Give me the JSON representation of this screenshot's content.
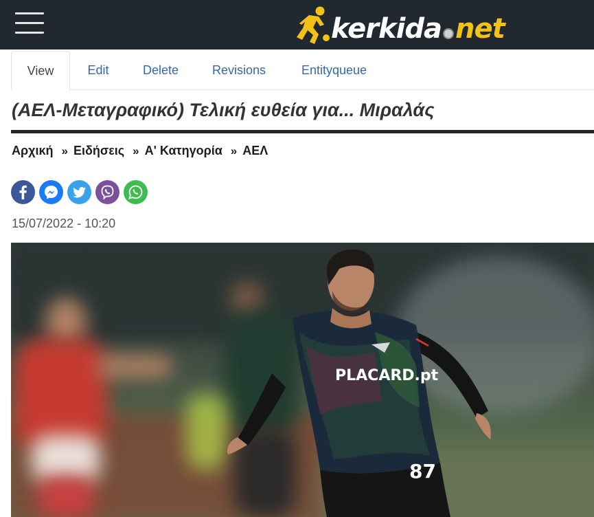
{
  "header": {
    "menu_icon": "hamburger-menu-icon",
    "logo": {
      "word": "kerkida",
      "tld": "net",
      "separator_icon": "football-icon",
      "mark_icon": "running-player-icon",
      "mark_color": "#f2c316"
    }
  },
  "tabs": [
    {
      "label": "View",
      "active": true
    },
    {
      "label": "Edit",
      "active": false
    },
    {
      "label": "Delete",
      "active": false
    },
    {
      "label": "Revisions",
      "active": false
    },
    {
      "label": "Entityqueue",
      "active": false
    }
  ],
  "article": {
    "title": "(ΑΕΛ-Μεταγραφικό) Τελική ευθεία για... Μιραλάς",
    "breadcrumb": [
      "Αρχική",
      "Ειδήσεις",
      "Α' Κατηγορία",
      "ΑΕΛ"
    ],
    "breadcrumb_separator": "»",
    "date": "15/07/2022 - 10:20",
    "share_buttons": [
      {
        "icon": "facebook-icon",
        "color": "#3b5998"
      },
      {
        "icon": "messenger-icon",
        "color": "#1a7af8"
      },
      {
        "icon": "twitter-icon",
        "color": "#3aa2e8"
      },
      {
        "icon": "viber-icon",
        "color": "#7b519d"
      },
      {
        "icon": "whatsapp-icon",
        "color": "#3fbc50"
      }
    ],
    "photo": {
      "subject": "football-player-photo",
      "shirt_sponsor": "PLACARD.pt",
      "shirt_number": "87"
    }
  },
  "colors": {
    "header_bg": "#212830",
    "link": "#3468a8",
    "logo_accent": "#f2c316"
  }
}
